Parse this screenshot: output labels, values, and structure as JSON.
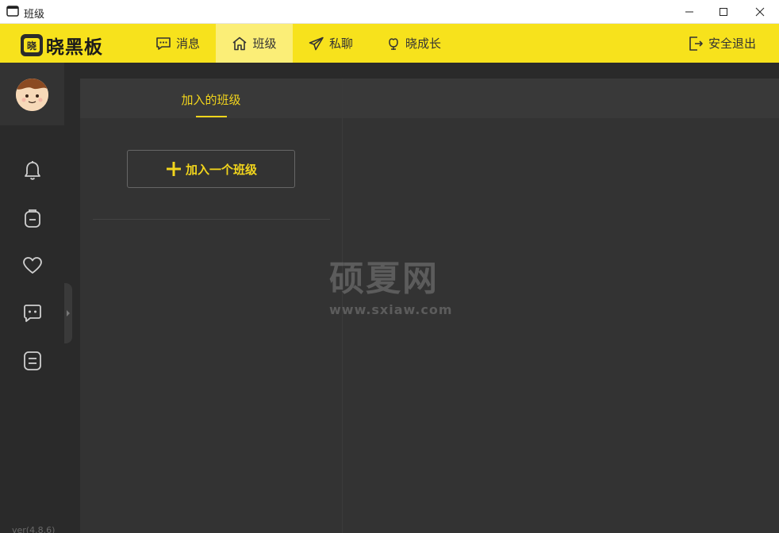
{
  "window": {
    "title": "班级",
    "minimize_icon": "minimize-icon",
    "maximize_icon": "maximize-icon",
    "close_icon": "close-icon"
  },
  "topbar": {
    "logo_text": "晓黑板",
    "nav": [
      {
        "label": "消息",
        "icon": "message-icon"
      },
      {
        "label": "班级",
        "icon": "home-icon",
        "active": true
      },
      {
        "label": "私聊",
        "icon": "send-icon"
      },
      {
        "label": "晓成长",
        "icon": "growth-icon"
      }
    ],
    "exit_label": "安全退出"
  },
  "sidebar": {
    "icons": [
      "bell-icon",
      "backpack-icon",
      "heart-icon",
      "chat-bot-icon",
      "note-icon"
    ],
    "version": "ver(4.8.6)"
  },
  "class_panel": {
    "tab_label": "加入的班级",
    "join_button_label": "加入一个班级"
  },
  "watermark": {
    "cn": "硕夏网",
    "en": "www.sxiaw.com"
  },
  "colors": {
    "brand_yellow": "#f7e21c",
    "accent_yellow": "#f2d51c",
    "dark_bg": "#2a2a2a",
    "panel_bg": "#333333"
  }
}
